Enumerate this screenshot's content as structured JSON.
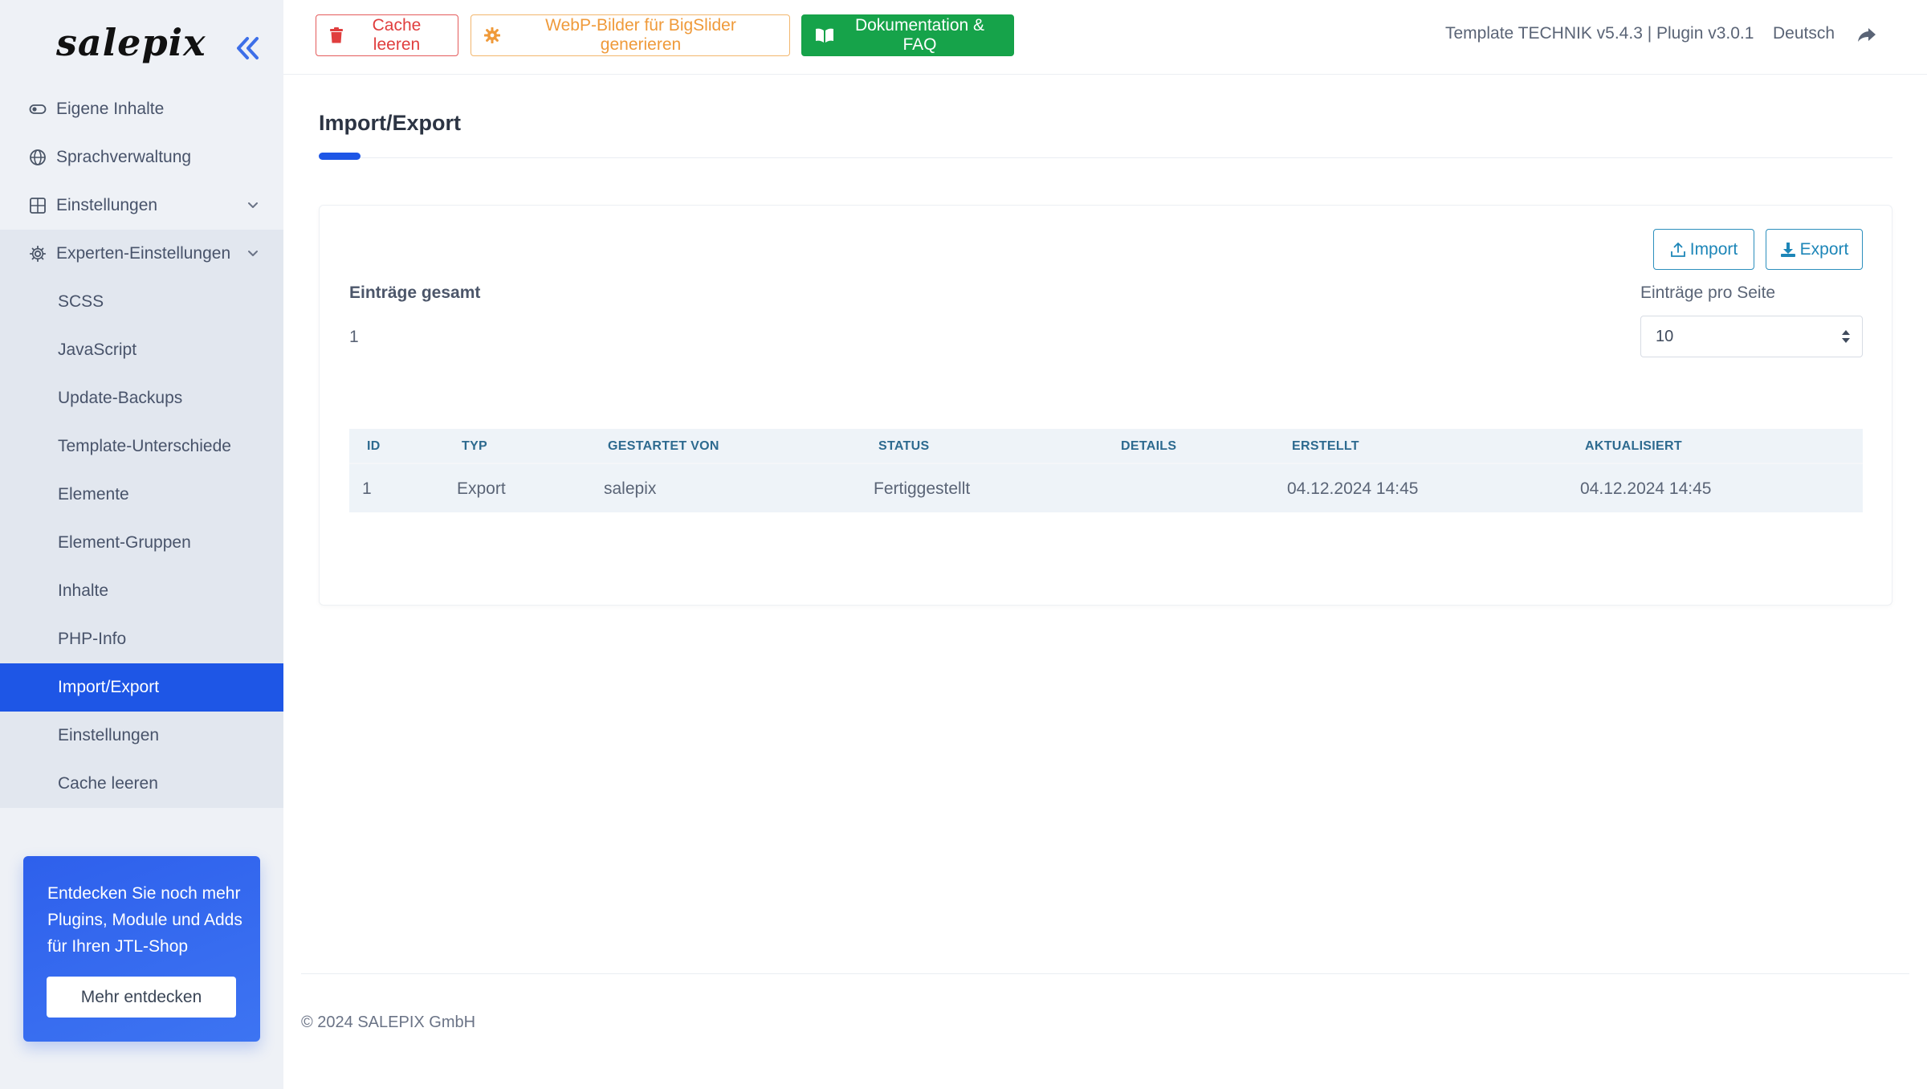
{
  "brand": {
    "logo_text": "salepix"
  },
  "sidebar": {
    "items": [
      {
        "label": "Eigene Inhalte",
        "icon": "toggle-icon"
      },
      {
        "label": "Sprachverwaltung",
        "icon": "globe-icon"
      },
      {
        "label": "Einstellungen",
        "icon": "grid-icon",
        "expandable": true
      },
      {
        "label": "Experten-Einstellungen",
        "icon": "gear-icon",
        "expandable": true,
        "expanded": true
      }
    ],
    "sub_items": [
      {
        "label": "SCSS"
      },
      {
        "label": "JavaScript"
      },
      {
        "label": "Update-Backups"
      },
      {
        "label": "Template-Unterschiede"
      },
      {
        "label": "Elemente"
      },
      {
        "label": "Element-Gruppen"
      },
      {
        "label": "Inhalte"
      },
      {
        "label": "PHP-Info"
      },
      {
        "label": "Import/Export",
        "active": true
      },
      {
        "label": "Einstellungen"
      },
      {
        "label": "Cache leeren"
      }
    ],
    "promo": {
      "text": "Entdecken Sie noch mehr Plugins, Module und Adds für Ihren JTL-Shop",
      "button": "Mehr entdecken"
    }
  },
  "topbar": {
    "cache_button": "Cache leeren",
    "webp_button": "WebP-Bilder für BigSlider generieren",
    "docs_button": "Dokumentation & FAQ",
    "version": "Template TECHNIK v5.4.3 | Plugin v3.0.1",
    "language": "Deutsch"
  },
  "page": {
    "title": "Import/Export"
  },
  "card": {
    "import_button": "Import",
    "export_button": "Export",
    "total_label": "Einträge gesamt",
    "total_value": "1",
    "per_page_label": "Einträge pro Seite",
    "per_page_value": "10"
  },
  "table": {
    "headers": [
      "ID",
      "TYP",
      "GESTARTET VON",
      "STATUS",
      "DETAILS",
      "ERSTELLT",
      "AKTUALISIERT"
    ],
    "rows": [
      [
        "1",
        "Export",
        "salepix",
        "Fertiggestellt",
        "",
        "04.12.2024 14:45",
        "04.12.2024 14:45"
      ]
    ]
  },
  "footer": {
    "copyright": "© 2024 SALEPIX GmbH"
  },
  "colors": {
    "primary": "#1e56e6",
    "sidebar_bg": "#eef1f6",
    "danger": "#e03e3e",
    "warning": "#ef9a3a",
    "success": "#16a34a",
    "info": "#1d86b8"
  }
}
